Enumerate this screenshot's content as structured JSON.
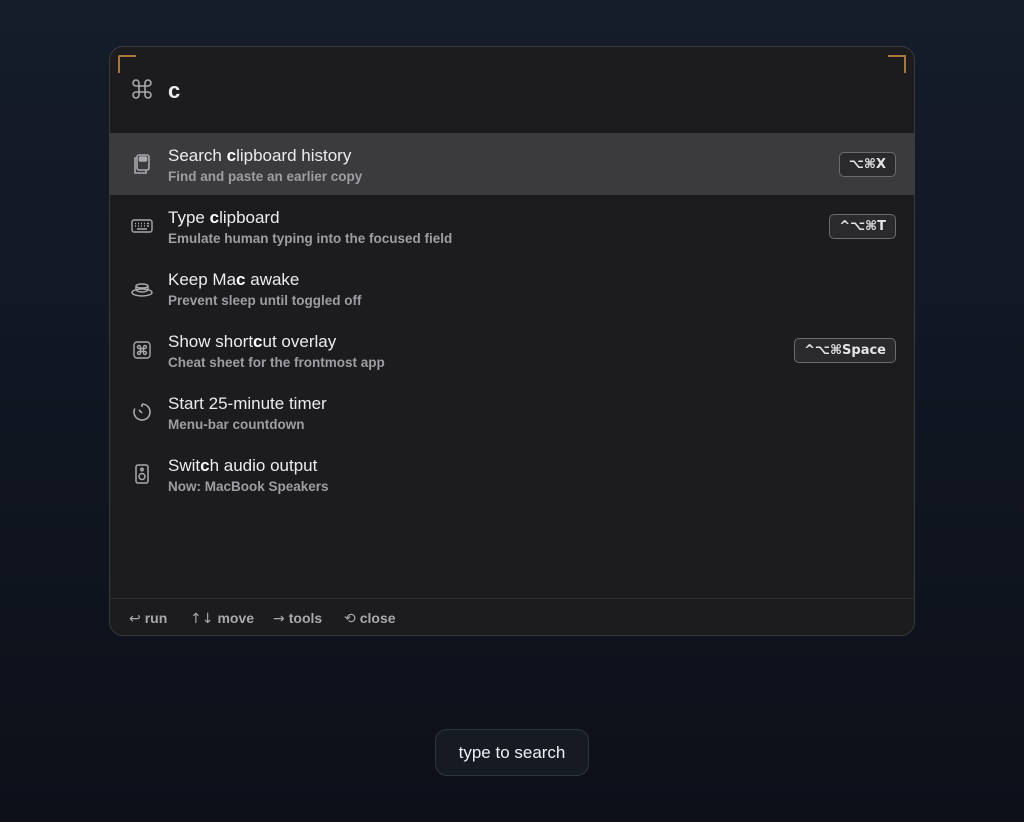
{
  "search": {
    "prefix_icon": "command-icon",
    "query": "c"
  },
  "results": [
    {
      "icon": "clipboard-icon",
      "title_parts": [
        "Search ",
        "c",
        "lipboard history"
      ],
      "subtitle": "Find and paste an earlier copy",
      "shortcut": "⌥⌘X",
      "selected": true
    },
    {
      "icon": "keyboard-icon",
      "title_parts": [
        "Type ",
        "c",
        "lipboard"
      ],
      "subtitle": "Emulate human typing into the focused field",
      "shortcut": "^⌥⌘T",
      "selected": false
    },
    {
      "icon": "coffee-cup-icon",
      "title_parts": [
        "Keep Ma",
        "c",
        " awake"
      ],
      "subtitle": "Prevent sleep until toggled off",
      "shortcut": "",
      "selected": false
    },
    {
      "icon": "command-key-icon",
      "title_parts": [
        "Show short",
        "c",
        "ut overlay"
      ],
      "subtitle": "Cheat sheet for the frontmost app",
      "shortcut": "^⌥⌘Space",
      "selected": false
    },
    {
      "icon": "timer-icon",
      "title_parts": [
        "Start 25-minute timer",
        "",
        ""
      ],
      "subtitle": "Menu-bar countdown",
      "shortcut": "",
      "selected": false
    },
    {
      "icon": "speaker-icon",
      "title_parts": [
        "Swit",
        "c",
        "h audio output"
      ],
      "subtitle": "Now: MacBook Speakers",
      "shortcut": "",
      "selected": false
    }
  ],
  "footer": {
    "run": {
      "glyph": "↩",
      "label": "run"
    },
    "move": {
      "glyph": "↑↓",
      "label": "move"
    },
    "tools": {
      "glyph": "→",
      "label": "tools"
    },
    "close": {
      "glyph": "⟲",
      "label": "close"
    }
  },
  "bottom_pill": "type to search",
  "colors": {
    "accent_corner": "#a6793a",
    "selected_row": "#3b3b3e",
    "panel": "#1c1c1e"
  }
}
